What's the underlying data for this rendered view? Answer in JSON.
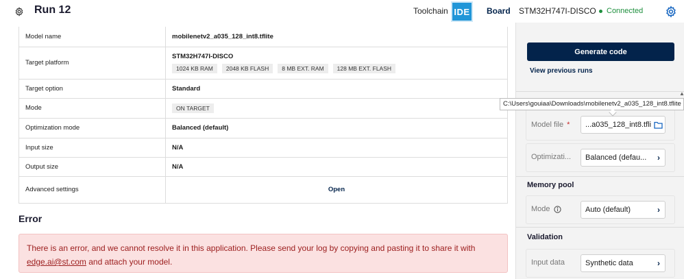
{
  "header": {
    "run_title": "Run 12",
    "toolchain_label": "Toolchain",
    "toolchain_badge": "IDE",
    "board_label": "Board",
    "board_value": "STM32H747I-DISCO",
    "status": "Connected"
  },
  "params": {
    "rows": [
      {
        "key": "Model name",
        "value": "mobilenetv2_a035_128_int8.tflite"
      },
      {
        "key": "Target platform",
        "value": "STM32H747I-DISCO",
        "chips": [
          "1024 KB RAM",
          "2048 KB FLASH",
          "8 MB EXT. RAM",
          "128 MB EXT. FLASH"
        ]
      },
      {
        "key": "Target option",
        "value": "Standard"
      },
      {
        "key": "Mode",
        "chip": "ON TARGET"
      },
      {
        "key": "Optimization mode",
        "value": "Balanced (default)"
      },
      {
        "key": "Input size",
        "value": "N/A"
      },
      {
        "key": "Output size",
        "value": "N/A"
      },
      {
        "key": "Advanced settings",
        "link": "Open"
      }
    ]
  },
  "error": {
    "heading": "Error",
    "message": "There is an error, and we cannot resolve it in this application. Please send your log by copying and pasting it to share it with",
    "email": "edge.ai@st.com",
    "suffix": "and attach your model."
  },
  "panel": {
    "generate_button": "Generate code",
    "previous_runs_link": "View previous runs",
    "tooltip": "C:\\Users\\gouiaa\\Downloads\\mobilenetv2_a035_128_int8.tflite",
    "model_file_label": "Model file",
    "model_file_required": "*",
    "model_file_value": "...a035_128_int8.tflite",
    "optimization_label": "Optimizati...",
    "optimization_value": "Balanced (defau...",
    "memory_pool_title": "Memory pool",
    "mode_label": "Mode",
    "mode_value": "Auto (default)",
    "validation_title": "Validation",
    "input_data_label": "Input data",
    "input_data_value": "Synthetic data"
  },
  "colors": {
    "primary": "#03234b",
    "ide_badge": "#2196d8",
    "connected": "#1e8f3e",
    "error_bg": "#fbe1e1",
    "error_text": "#9b1c1c"
  }
}
